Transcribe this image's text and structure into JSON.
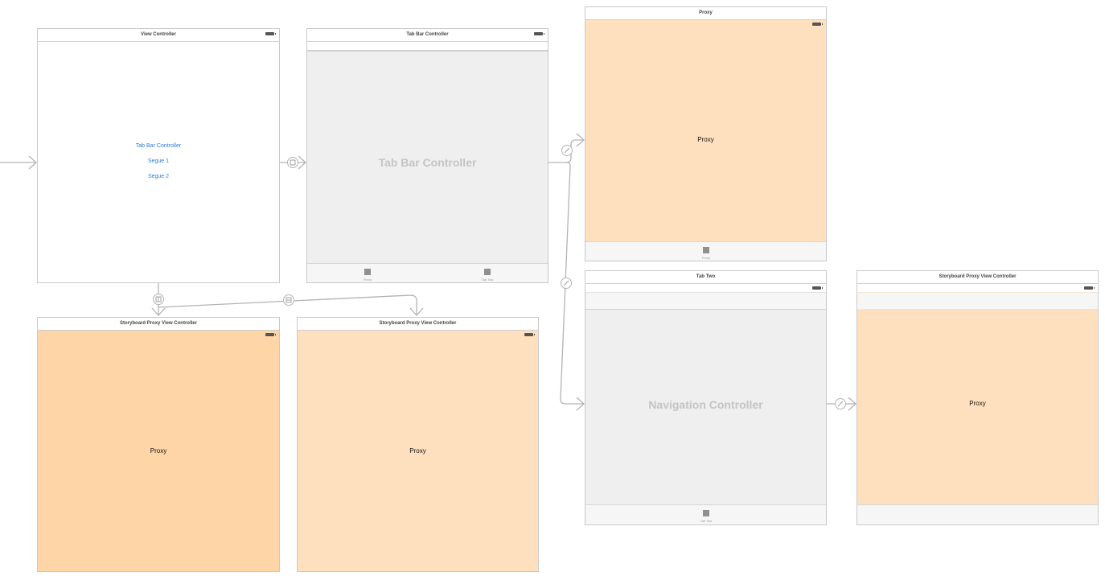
{
  "scenes": {
    "view_controller": {
      "title": "View Controller",
      "buttons": [
        "Tab Bar Controller",
        "Segue 1",
        "Segue 2"
      ]
    },
    "tab_bar_controller": {
      "title": "Tab Bar Controller",
      "placeholder": "Tab Bar Controller",
      "tabs": [
        "Proxy",
        "Tab Two"
      ]
    },
    "proxy": {
      "title": "Proxy",
      "content": "Proxy",
      "tab": "Proxy"
    },
    "tab_two": {
      "title": "Tab Two",
      "placeholder": "Navigation Controller",
      "tab": "Tab Two"
    },
    "storyboard_proxy_right": {
      "title": "Storyboard Proxy View Controller",
      "content": "Proxy"
    },
    "storyboard_proxy_1": {
      "title": "Storyboard Proxy View Controller",
      "content": "Proxy"
    },
    "storyboard_proxy_2": {
      "title": "Storyboard Proxy View Controller",
      "content": "Proxy"
    }
  },
  "colors": {
    "proxy_background": "#fee0be",
    "proxy_background_alt": "#fed5a7",
    "placeholder_background": "#efefef",
    "link_text": "#2f7cd6",
    "connection_line": "#b3b3b3"
  },
  "icons": {
    "tab_item": "square-icon",
    "battery": "battery-icon"
  }
}
